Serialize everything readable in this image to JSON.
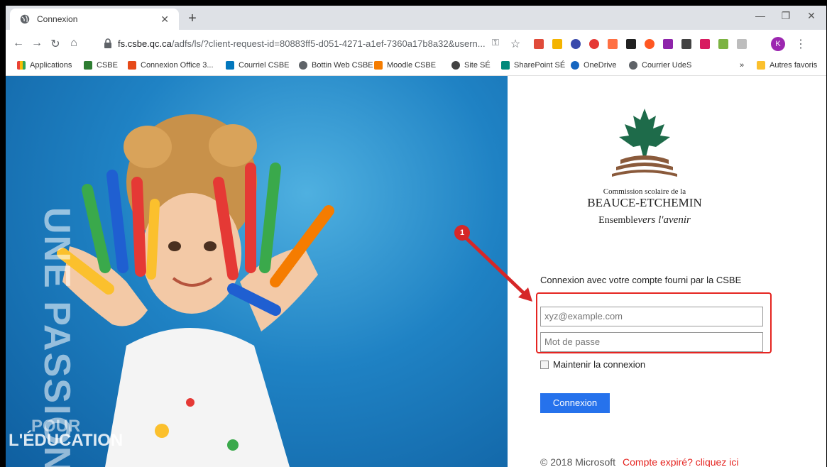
{
  "browser": {
    "tab_title": "Connexion",
    "url_host": "fs.csbe.qc.ca",
    "url_path": "/adfs/ls/?client-request-id=80883ff5-d051-4271-a1ef-7360a17b8a32&usern...",
    "profile_initial": "K"
  },
  "bookmarks": {
    "apps": "Applications",
    "items": [
      "CSBE",
      "Connexion Office 3...",
      "Courriel CSBE",
      "Bottin Web CSBE",
      "Moodle CSBE",
      "Site SÉ",
      "SharePoint SÉ",
      "OneDrive",
      "Courrier UdeS"
    ],
    "overflow": "»",
    "other": "Autres favoris"
  },
  "hero": {
    "vertical_text": "UNE PASSION",
    "pour": "POUR",
    "education": "L'ÉDUCATION"
  },
  "logo": {
    "line1": "Commission scolaire de la",
    "line2": "BEAUCE-ETCHEMIN",
    "tagline_a": "Ensemble",
    "tagline_b": "vers l'avenir"
  },
  "form": {
    "heading": "Connexion avec votre compte fourni par la CSBE",
    "email_placeholder": "xyz@example.com",
    "password_placeholder": "Mot de passe",
    "keep_signed_in": "Maintenir la connexion",
    "submit": "Connexion"
  },
  "footer": {
    "copyright": "© 2018 Microsoft",
    "expired_link": "Compte expiré? cliquez ici"
  },
  "annotation": {
    "step": "1"
  },
  "colors": {
    "accent": "#2672ec",
    "highlight": "#e52521",
    "badge": "#d62728"
  }
}
